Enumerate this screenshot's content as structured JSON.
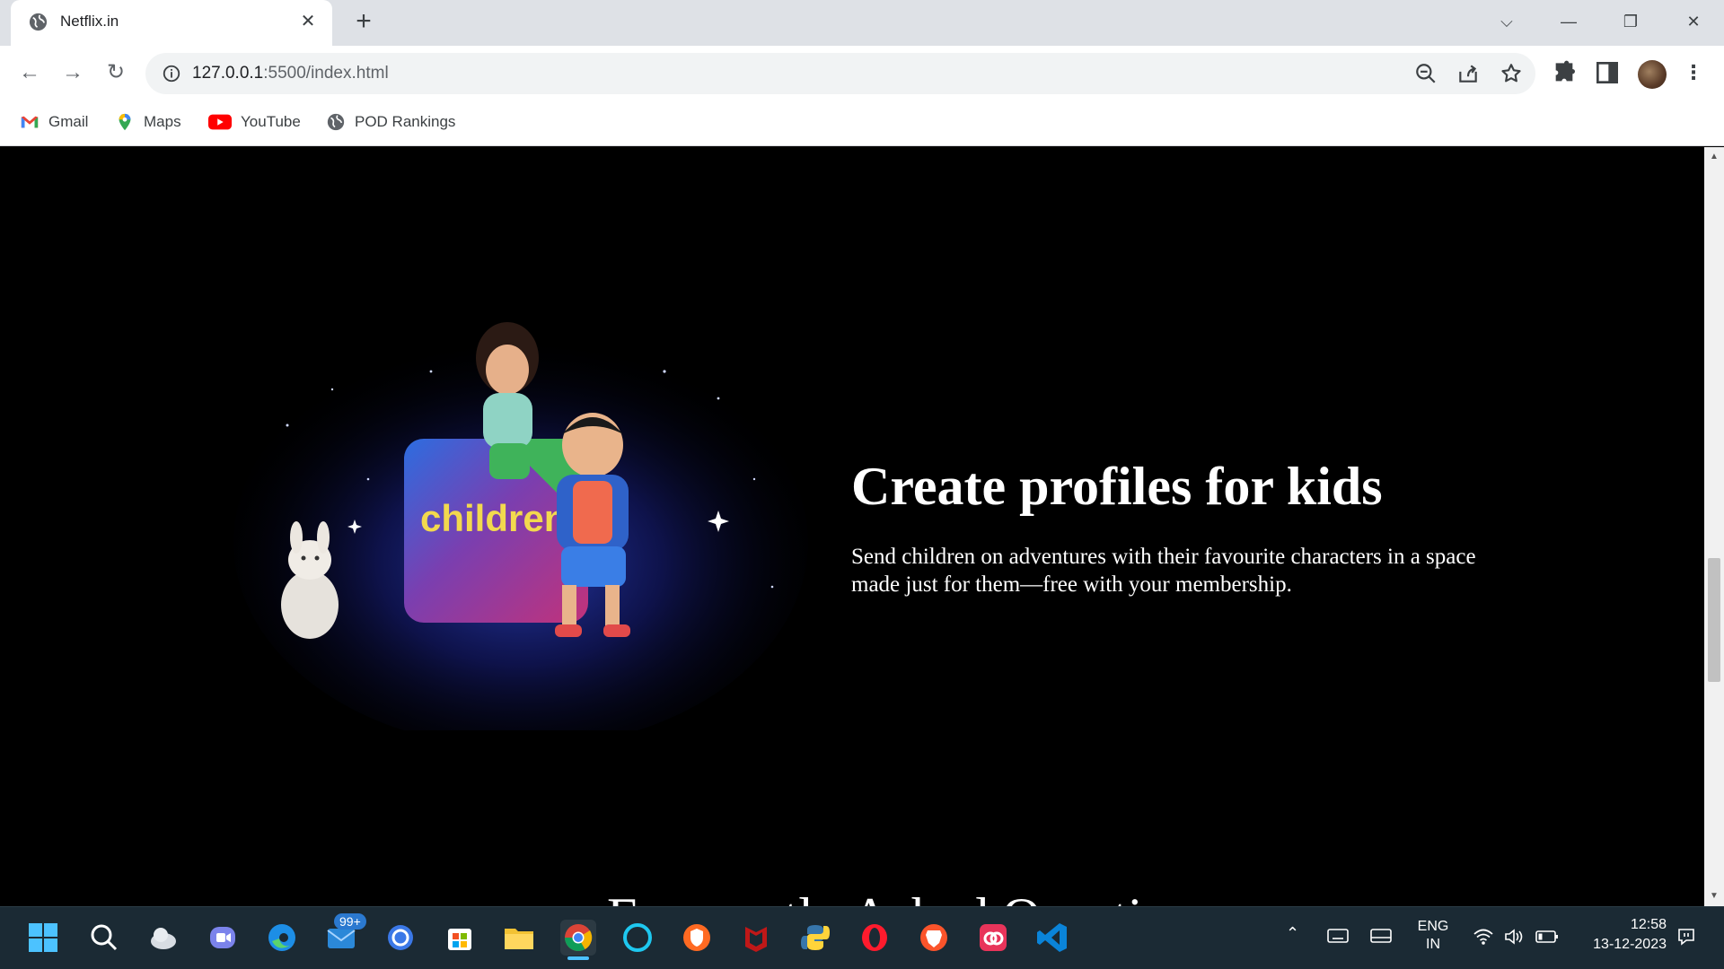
{
  "browser": {
    "tab_title": "Netflix.in",
    "url_host": "127.0.0.1",
    "url_rest": ":5500/index.html",
    "bookmarks": [
      {
        "label": "Gmail",
        "icon": "gmail-icon"
      },
      {
        "label": "Maps",
        "icon": "maps-icon"
      },
      {
        "label": "YouTube",
        "icon": "youtube-icon"
      },
      {
        "label": "POD Rankings",
        "icon": "globe-icon"
      }
    ]
  },
  "page": {
    "heading": "Create profiles for kids",
    "description": "Send children on adventures with their favourite characters in a space made just for them—free with your membership.",
    "image_label": "children",
    "next_heading": "Frequently Asked Questions"
  },
  "taskbar": {
    "mail_badge": "99+",
    "lang_top": "ENG",
    "lang_bottom": "IN",
    "time": "12:58",
    "date": "13-12-2023"
  },
  "colors": {
    "page_bg": "#000000",
    "taskbar_bg": "#1b2a34",
    "chrome_tabstrip": "#dee1e6"
  }
}
